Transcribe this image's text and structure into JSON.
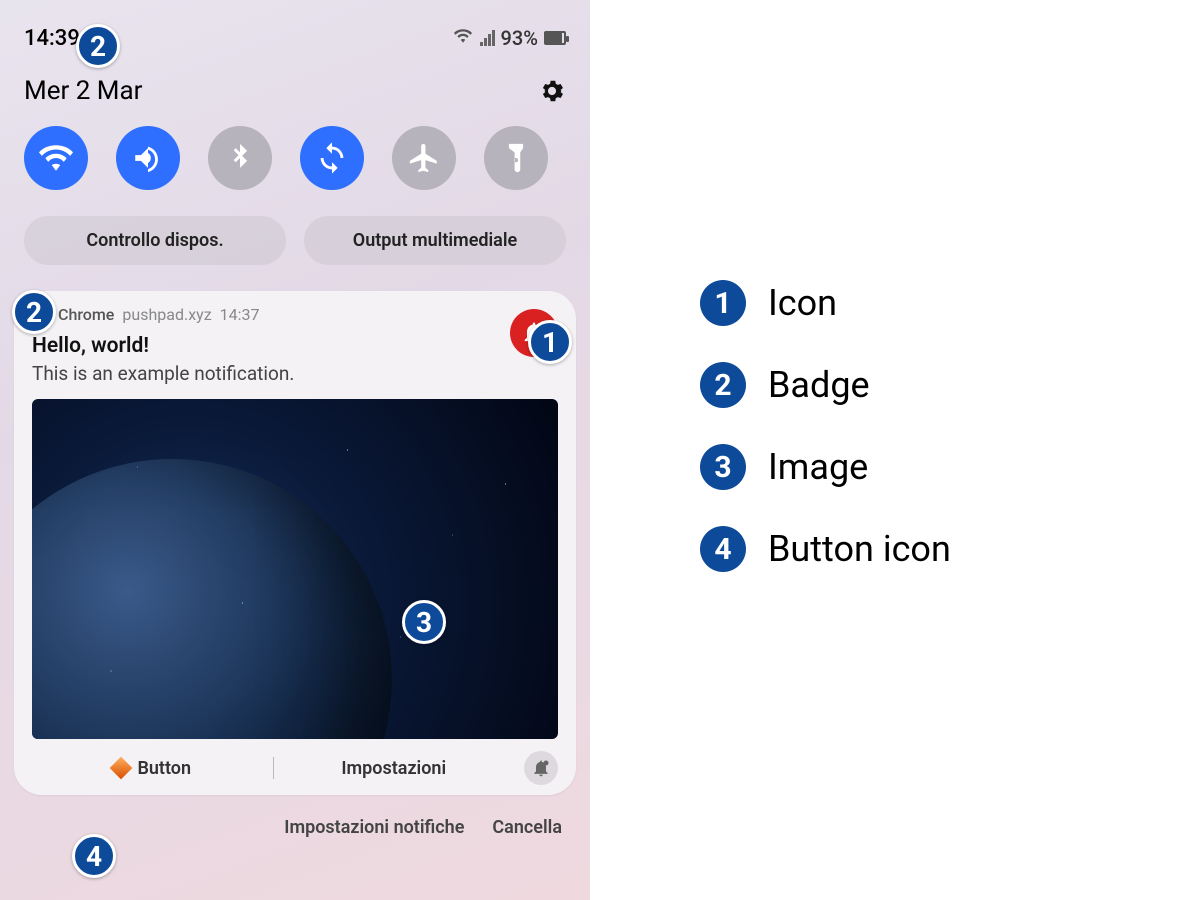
{
  "status": {
    "time": "14:39",
    "battery_pct": "93%"
  },
  "date": "Mer 2 Mar",
  "pills": {
    "device_control": "Controllo dispos.",
    "media_output": "Output multimediale"
  },
  "notification": {
    "app": "Chrome",
    "domain": "pushpad.xyz",
    "time": "14:37",
    "title": "Hello, world!",
    "body": "This is an example notification.",
    "action_button": "Button",
    "action_settings": "Impostazioni"
  },
  "bottom": {
    "settings": "Impostazioni notifiche",
    "clear": "Cancella"
  },
  "legend": {
    "items": [
      {
        "num": "1",
        "label": "Icon"
      },
      {
        "num": "2",
        "label": "Badge"
      },
      {
        "num": "3",
        "label": "Image"
      },
      {
        "num": "4",
        "label": "Button icon"
      }
    ]
  },
  "callouts": {
    "c1": "1",
    "c2a": "2",
    "c2b": "2",
    "c3": "3",
    "c4": "4"
  }
}
